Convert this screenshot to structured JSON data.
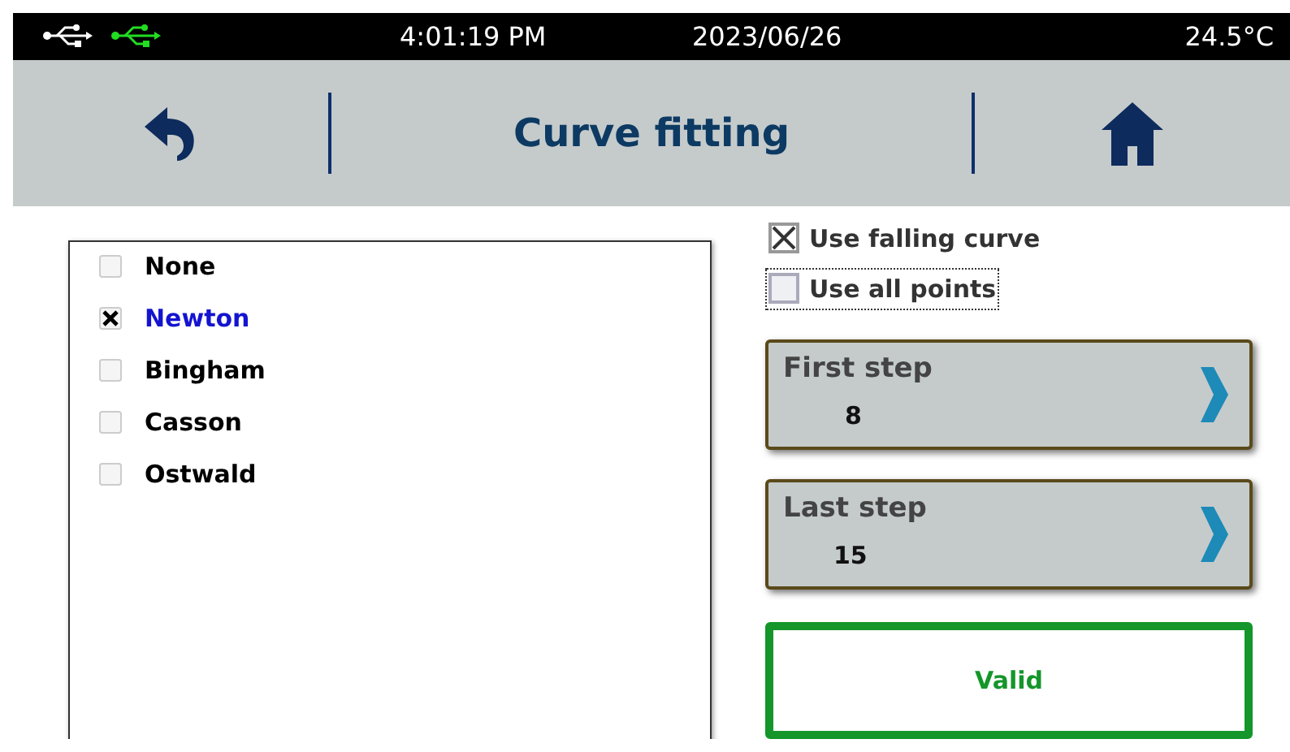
{
  "status_bar": {
    "usb_icons": [
      {
        "color": "#ffffff"
      },
      {
        "color": "#22dd22"
      }
    ],
    "time": "4:01:19 PM",
    "date": "2023/06/26",
    "temperature": "24.5°C"
  },
  "header": {
    "title": "Curve fitting"
  },
  "models": [
    {
      "label": "None",
      "checked": false
    },
    {
      "label": "Newton",
      "checked": true
    },
    {
      "label": "Bingham",
      "checked": false
    },
    {
      "label": "Casson",
      "checked": false
    },
    {
      "label": "Ostwald",
      "checked": false
    }
  ],
  "options": [
    {
      "label": "Use falling curve",
      "checked": true,
      "focused": false
    },
    {
      "label": "Use all points",
      "checked": false,
      "focused": true
    }
  ],
  "steps": [
    {
      "label": "First step",
      "value": "8"
    },
    {
      "label": "Last step",
      "value": "15"
    }
  ],
  "status": {
    "text": "Valid"
  }
}
